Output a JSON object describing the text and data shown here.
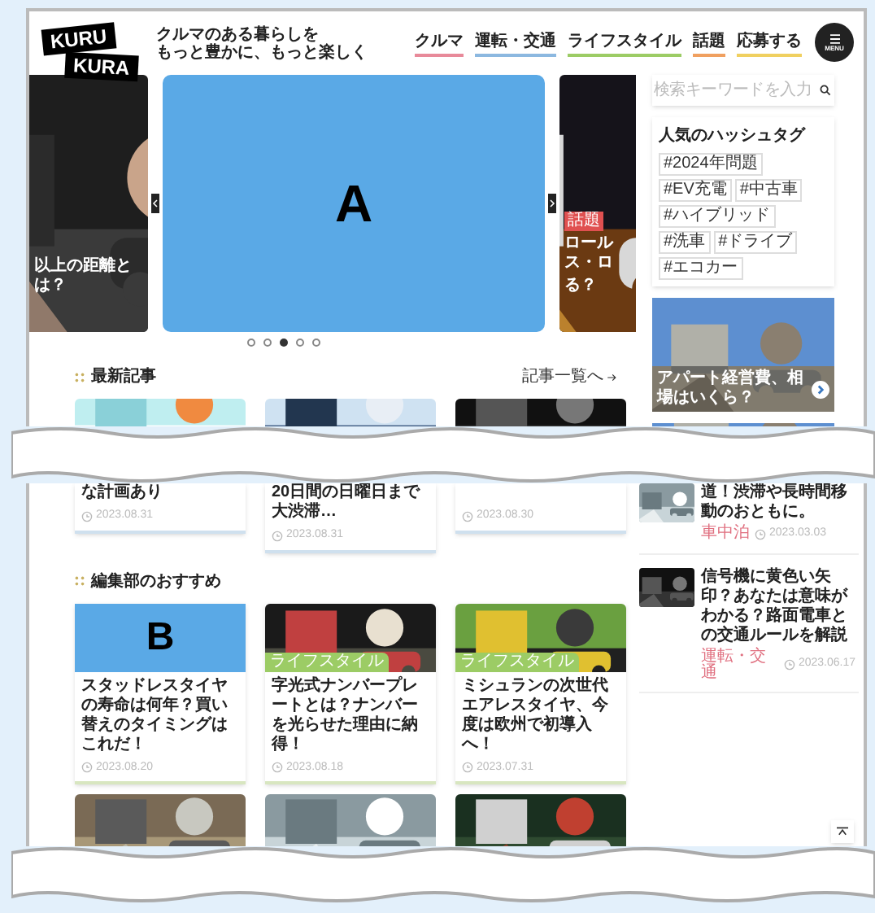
{
  "logo": [
    "KURU",
    "KURA"
  ],
  "tagline": [
    "クルマのある暮らしを",
    "もっと豊かに、もっと楽しく"
  ],
  "nav": [
    {
      "label": "クルマ",
      "color": "#e88a9a"
    },
    {
      "label": "運転・交通",
      "color": "#8cb8e0"
    },
    {
      "label": "ライフスタイル",
      "color": "#9ccc65"
    },
    {
      "label": "話題",
      "color": "#f0a060"
    },
    {
      "label": "応募する",
      "color": "#f0d060"
    }
  ],
  "menu_button": {
    "label": "MENU"
  },
  "hero": {
    "slides": [
      {
        "kind": "picture",
        "caption": "以上の距離とは？"
      },
      {
        "kind": "redacted",
        "label": "A"
      },
      {
        "kind": "picture",
        "tag": "話題",
        "caption": "ロールス・ロ",
        "caption_2": "る？"
      }
    ],
    "dots": [
      {
        "selected": false
      },
      {
        "selected": false
      },
      {
        "selected": true
      },
      {
        "selected": false
      },
      {
        "selected": false
      }
    ]
  },
  "search": {
    "placeholder": "検索キーワードを入力"
  },
  "hashtags": {
    "title": "人気のハッシュタグ",
    "tags": [
      "#2024年問題",
      "#EV充電",
      "#中古車",
      "#ハイブリッド",
      "#洗車",
      "#ドライブ",
      "#エコカー"
    ]
  },
  "sidebar_ad": {
    "caption": "アパート経営費、相場はいくら？"
  },
  "latest": {
    "title": "最新記事",
    "more": "記事一覧へ",
    "cards": [
      {
        "title": "な計画あり",
        "date": "2023.08.31"
      },
      {
        "title": "20日間の日曜日まで大渋滞…",
        "date": "2023.08.31"
      },
      {
        "date": "2023.08.30"
      }
    ]
  },
  "sidebar_articles": [
    {
      "title": "道！渋滞や長時間移動のおともに。",
      "tag": "車中泊",
      "date": "2023.03.03"
    },
    {
      "title": "信号機に黄色い矢印？あなたは意味がわかる？路面電車との交通ルールを解説",
      "tag": "運転・交通",
      "date": "2023.06.17"
    }
  ],
  "picks": {
    "title": "編集部のおすすめ",
    "cards": [
      {
        "kind": "redacted",
        "label": "B",
        "title": "スタッドレスタイヤの寿命は何年？買い替えのタイミングはこれだ！",
        "date": "2023.08.20"
      },
      {
        "kind": "picture",
        "tag": "ライフスタイル",
        "title": "字光式ナンバープレートとは？ナンバーを光らせた理由に納得！",
        "date": "2023.08.18"
      },
      {
        "kind": "picture",
        "tag": "ライフスタイル",
        "title": "ミシュランの次世代エアレスタイヤ、今度は欧州で初導入へ！",
        "date": "2023.07.31"
      }
    ]
  },
  "more_cards": [
    {
      "kind": "picture"
    },
    {
      "kind": "picture"
    },
    {
      "kind": "picture"
    }
  ]
}
